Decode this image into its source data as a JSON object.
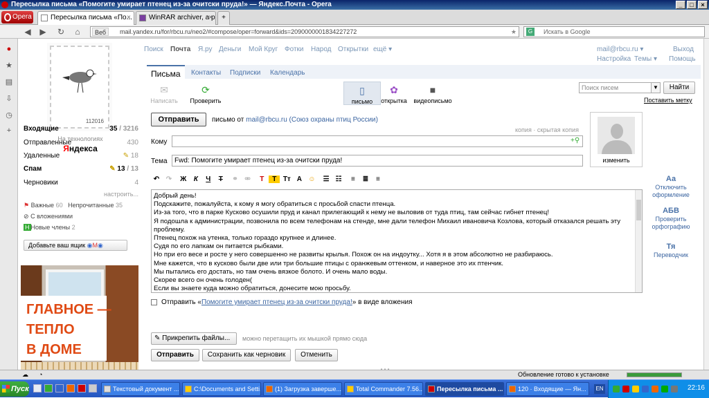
{
  "window": {
    "title": "Пересылка письма «Помогите умирает птенец из-за очитски пруда!» — Яндекс.Почта - Opera"
  },
  "browser": {
    "opera_label": "Opera",
    "tabs": [
      {
        "label": "Пересылка письма «По..."
      },
      {
        "label": "WinRAR archiver, a pow..."
      }
    ],
    "url": "mail.yandex.ru/for/rbcu.ru/neo2/#compose/oper=forward&ids=2090000001834227272",
    "url_prefix": "Веб",
    "search_placeholder": "Искать в Google"
  },
  "sidebar": {
    "stamp_number": "112016",
    "tech": "На технологиях",
    "yandex_red": "Я",
    "yandex_rest": "ндекса",
    "folders": [
      {
        "label": "Входящие",
        "count_bold": "35",
        "count": "/ 3216"
      },
      {
        "label": "Отправленные",
        "count_bold": "",
        "count": "430"
      },
      {
        "label": "Удаленные",
        "count_bold": "",
        "count": "18"
      },
      {
        "label": "Спам",
        "count_bold": "13",
        "count": "/ 13"
      },
      {
        "label": "Черновики",
        "count_bold": "",
        "count": "4"
      }
    ],
    "configure": "настроить...",
    "important": "Важные",
    "important_count": "60",
    "unread": "Непрочитанные",
    "unread_count": "35",
    "with_attachments": "С вложениями",
    "new_members": "Новые члены",
    "new_members_count": "2",
    "add_box": "Добавьте ваш ящик",
    "banner": [
      "ГЛАВНОЕ —",
      "ТЕПЛО",
      "В ДОМЕ"
    ]
  },
  "topnav": {
    "items": [
      "Поиск",
      "Почта",
      "Я.ру",
      "Деньги",
      "Мой Круг",
      "Фотки",
      "Народ",
      "Открытки",
      "ещё ▾"
    ],
    "user": "mail@rbcu.ru ▾",
    "logout": "Выход",
    "settings": "Настройка",
    "themes": "Темы ▾",
    "help": "Помощь"
  },
  "mail_tabs": [
    "Письма",
    "Контакты",
    "Подписки",
    "Календарь"
  ],
  "toolbar": {
    "write": "Написать",
    "check": "Проверить",
    "letter": "письмо",
    "postcard": "открытка",
    "video": "видеописьмо",
    "search_placeholder": "Поиск писем",
    "find": "Найти",
    "install": "Поставить метку"
  },
  "compose": {
    "send": "Отправить",
    "from_label": "письмо от",
    "from_value": "mail@rbcu.ru (Союз охраны птиц России)",
    "copy": "копия",
    "bcc": "скрытая копия",
    "to_label": "Кому",
    "to_value": "",
    "subject_label": "Тема",
    "subject_value": "Fwd: Помогите умирает птенец из-за очитски пруда!",
    "change_photo": "изменить",
    "body_lines": [
      "Добрый день!",
      "Подскажите, пожалуйста, к кому я могу обратиться с просьбой спасти птенца.",
      "Из-за того, что в парке Кусково осушили пруд и канал прилегающий к нему не выловив от туда птиц, там сейчас гибнет птенец!",
      "Я подошла к администрации, позвонила по всем телефонам на стенде, мне дали телефон Михаил ивановича Козлова, который отказался решать эту проблему.",
      "Птенец похож на утенка, только гораздо крупнее и длинее.",
      "Судя по его лапкам он питается рыбками.",
      "Но при его весе и росте у него совершенно не развиты крылья. Похож он на индоутку... Хотя я в этом абсолютно не  разбираюсь.",
      "Мне кажется, что в кусково были две или три большие птицы с оранжевым оттенком, и наверное это их птенчик.",
      "Мы пытались его достать, но там очень вязкое болото. И очень мало воды.",
      "Скорее всего он очень голоден(",
      "Если вы знаете куда можно обратиться, донесите мою просьбу."
    ],
    "attach_prefix": "Отправить «",
    "attach_link": "Помогите умирает птенец из-за очитски пруда!",
    "attach_suffix": "» в виде вложения",
    "attach_files": "Прикрепить файлы...",
    "drag_hint": "можно перетащить их мышкой прямо сюда",
    "send_bottom": "Отправить",
    "save_draft": "Сохранить как черновик",
    "cancel": "Отменить"
  },
  "right_tools": [
    {
      "icon": "Аа",
      "line1": "Отключить",
      "line2": "оформление"
    },
    {
      "icon": "АБВ",
      "line1": "Проверить",
      "line2": "орфографию"
    },
    {
      "icon": "Тя",
      "line1": "Переводчик",
      "line2": ""
    }
  ],
  "statusbar": {
    "text": "Обновление готово к установке"
  },
  "taskbar": {
    "start": "Пуск",
    "tasks": [
      "Текстовый документ ...",
      "C:\\Documents and Setti...",
      "(1) Загрузка заверше...",
      "Total Commander 7.56...",
      "Пересылка письма ...",
      "120 · Входящие — Ян..."
    ],
    "lang": "EN",
    "clock": "22:16"
  }
}
